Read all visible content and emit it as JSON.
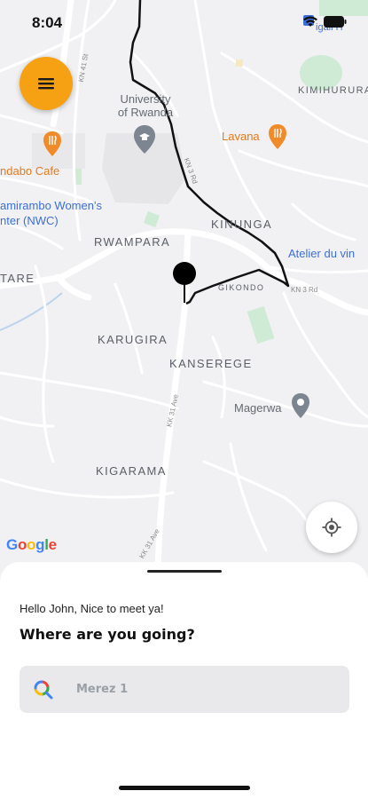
{
  "status_bar": {
    "time": "8:04"
  },
  "map": {
    "labels": {
      "kimihurura": "KIMIHURURA",
      "lavana": "Lavana",
      "university": "University of Rwanda",
      "kinunga": "KINUNGA",
      "rwampara": "RWAMPARA",
      "atelier": "Atelier du vin",
      "gikondo": "GIKONDO",
      "karugira": "KARUGIRA",
      "kanserege": "KANSEREGE",
      "magerwa": "Magerwa",
      "kigarama": "KIGARAMA",
      "ndabo": "ndabo Cafe",
      "nyamirambo": "amirambo Women's",
      "nwc": "nter (NWC)",
      "tare": "TARE",
      "kigali_fragment": "igali H",
      "street_kn41": "KN 41 St",
      "street_kn3": "KN 3 Rd",
      "street_kk31": "KK 31 Ave",
      "street_kk31b": "KK 31 Ave",
      "street_kn3d": "KN 3 Rd",
      "street_knst": "KN 41 St"
    },
    "google_logo": {
      "letters": [
        "G",
        "o",
        "o",
        "g",
        "l",
        "e"
      ]
    }
  },
  "colors": {
    "accent": "#F6A014",
    "route": "#111111",
    "park": "#CFEAD5",
    "google": [
      "#4285F4",
      "#EA4335",
      "#FBBC05",
      "#4285F4",
      "#34A853",
      "#EA4335"
    ]
  },
  "icons": {
    "menu": "hamburger-menu-icon",
    "locate": "crosshair-location-icon",
    "search": "search-icon",
    "pin": "current-location-pin-icon"
  },
  "sheet": {
    "greeting": "Hello John, Nice to meet ya!",
    "question": "Where are you going?",
    "search_value": "Merez 1"
  }
}
